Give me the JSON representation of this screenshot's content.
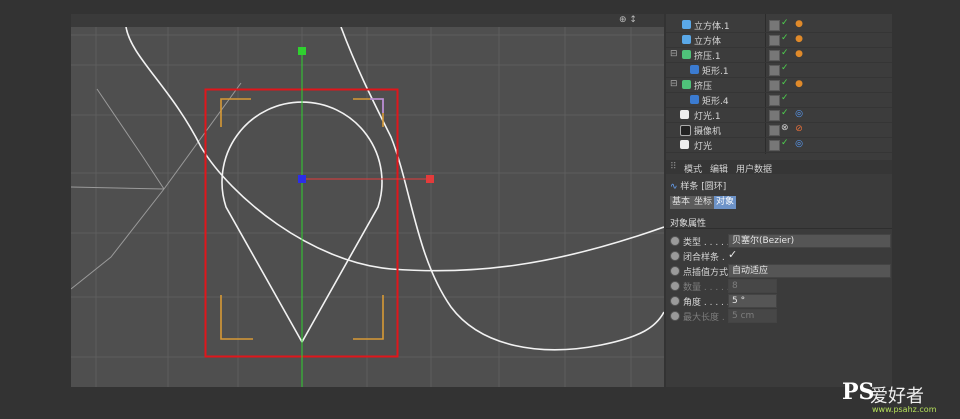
{
  "viewport": {
    "top_controls": "⊕ ↕"
  },
  "object_manager": {
    "items": [
      {
        "label": "立方体.1",
        "icon": "cube-icon",
        "tag": "material-tag"
      },
      {
        "label": "立方体",
        "icon": "cube-icon",
        "tag": "material-tag"
      },
      {
        "label": "挤压.1",
        "icon": "extrude-icon",
        "tag": "material-tag"
      },
      {
        "label": "矩形.1",
        "icon": "spline-icon",
        "tag": ""
      },
      {
        "label": "挤压",
        "icon": "extrude-icon",
        "tag": "material-tag"
      },
      {
        "label": "矩形.4",
        "icon": "spline-icon",
        "tag": ""
      },
      {
        "label": "灯光.1",
        "icon": "light-icon",
        "tag": "target-tag"
      },
      {
        "label": "摄像机",
        "icon": "camera-icon",
        "tag": "protection-tag"
      },
      {
        "label": "灯光",
        "icon": "light-icon",
        "tag": "target-tag"
      }
    ]
  },
  "attributes": {
    "menu": [
      "模式",
      "编辑",
      "用户数据"
    ],
    "object_title": "样条 [圆环]",
    "tabs": [
      "基本",
      "坐标",
      "对象"
    ],
    "active_tab": "对象",
    "section": "对象属性",
    "props": {
      "type": {
        "label": "类型",
        "value": "贝塞尔(Bezier)"
      },
      "closed": {
        "label": "闭合样条",
        "value": "✓"
      },
      "interp": {
        "label": "点插值方式",
        "value": "自动适应"
      },
      "count": {
        "label": "数量",
        "value": "8"
      },
      "angle": {
        "label": "角度",
        "value": "5 °"
      },
      "maxlen": {
        "label": "最大长度",
        "value": "5 cm"
      }
    }
  },
  "watermark": {
    "logo": "PS",
    "text": "爱好者",
    "url": "www.psahz.com"
  },
  "colors": {
    "selection_frame": "#e0161b",
    "y_axis": "#2fd12f",
    "x_axis": "#e33b3b",
    "origin": "#2c2ee8",
    "corner_marks": "#d89a36",
    "spline": "#ffffff"
  }
}
